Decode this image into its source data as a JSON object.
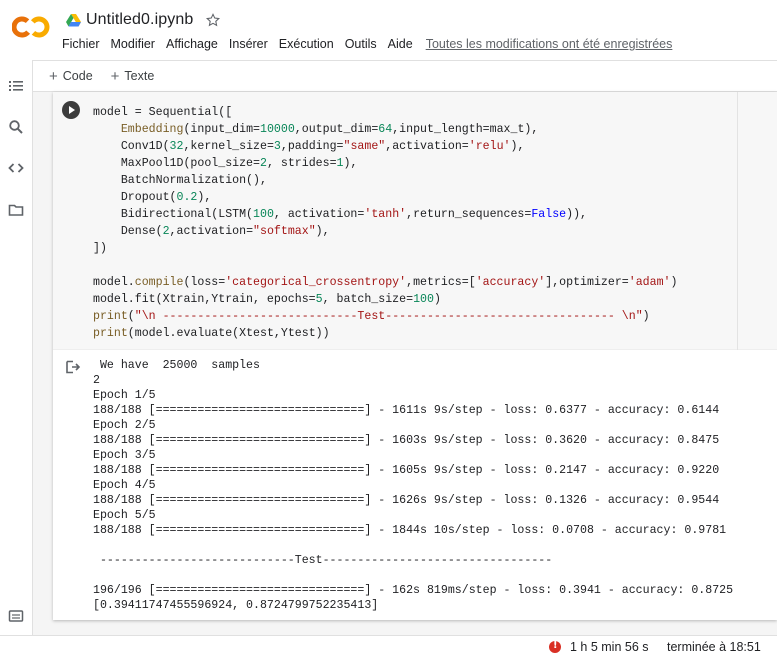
{
  "header": {
    "logo_text": "CO",
    "notebook_title": "Untitled0.ipynb",
    "menu": [
      "Fichier",
      "Modifier",
      "Affichage",
      "Insérer",
      "Exécution",
      "Outils",
      "Aide"
    ],
    "saved_status": "Toutes les modifications ont été enregistrées"
  },
  "toolbar": {
    "add_code_label": "Code",
    "add_text_label": "Texte"
  },
  "sidebar": {
    "icons": [
      "list-icon",
      "search-icon",
      "code-icon",
      "folder-icon",
      "terminal-icon"
    ]
  },
  "cell": {
    "code_lines": [
      "model = Sequential([",
      "    Embedding(input_dim=10000,output_dim=64,input_length=max_t),",
      "    Conv1D(32,kernel_size=3,padding=\"same\",activation='relu'),",
      "    MaxPool1D(pool_size=2, strides=1),",
      "    BatchNormalization(),",
      "    Dropout(0.2),",
      "    Bidirectional(LSTM(100, activation='tanh',return_sequences=False)),",
      "    Dense(2,activation=\"softmax\"),",
      "])",
      "",
      "model.compile(loss='categorical_crossentropy',metrics=['accuracy'],optimizer='adam')",
      "model.fit(Xtrain,Ytrain, epochs=5, batch_size=100)",
      "print(\"\\n ----------------------------Test--------------------------------- \\n\")",
      "print(model.evaluate(Xtest,Ytest))"
    ],
    "output_lines": [
      " We have  25000  samples",
      "2",
      "Epoch 1/5",
      "188/188 [==============================] - 1611s 9s/step - loss: 0.6377 - accuracy: 0.6144",
      "Epoch 2/5",
      "188/188 [==============================] - 1603s 9s/step - loss: 0.3620 - accuracy: 0.8475",
      "Epoch 3/5",
      "188/188 [==============================] - 1605s 9s/step - loss: 0.2147 - accuracy: 0.9220",
      "Epoch 4/5",
      "188/188 [==============================] - 1626s 9s/step - loss: 0.1326 - accuracy: 0.9544",
      "Epoch 5/5",
      "188/188 [==============================] - 1844s 10s/step - loss: 0.0708 - accuracy: 0.9781",
      "",
      " ----------------------------Test---------------------------------",
      "",
      "196/196 [==============================] - 162s 819ms/step - loss: 0.3941 - accuracy: 0.8725",
      "[0.39411747455596924, 0.8724799752235413]"
    ]
  },
  "status": {
    "runtime": "1 h 5 min 56 s",
    "finished": "terminée à 18:51"
  },
  "colors": {
    "logo_orange": "#f9ab00",
    "logo_dark_orange": "#e8710a",
    "error_red": "#d93025"
  }
}
